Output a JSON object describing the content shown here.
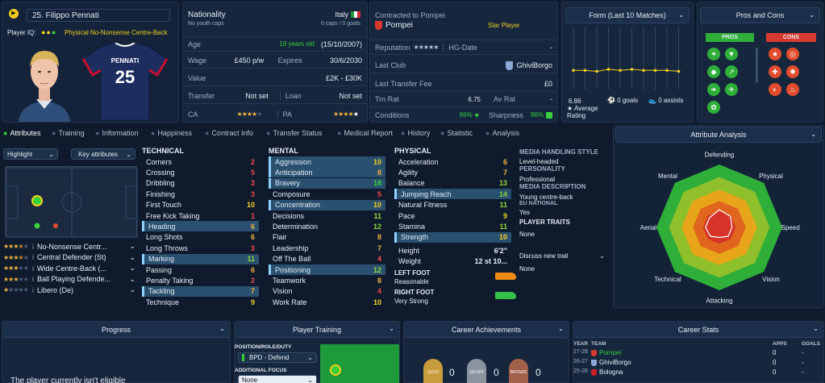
{
  "player": {
    "number_name": "25. Filippo Pennati",
    "iq_label": "Player IQ:",
    "role": "Physical No-Nonsense Centre-Back",
    "shirt_name": "PENNATI",
    "shirt_number": "25"
  },
  "info": {
    "nationality_label": "Nationality",
    "nationality": "Italy",
    "youth_caps": "No youth caps",
    "caps": "0 caps / 0 goals",
    "age_label": "Age",
    "age": "19 years old",
    "dob": "(15/10/2007)",
    "wage_label": "Wage",
    "wage": "£450 p/w",
    "expires_label": "Expires",
    "expires": "30/6/2030",
    "value_label": "Value",
    "value": "£2K - £30K",
    "transfer_label": "Transfer",
    "transfer": "Not set",
    "loan_label": "Loan",
    "loan": "Not set",
    "ca_label": "CA",
    "pa_label": "PA",
    "contracted_label": "Contracted to Pompei",
    "club": "Pompei",
    "status": "Star Player",
    "reputation_label": "Reputation",
    "reputation_right": "HG-Date",
    "reputation_right_value": "-",
    "last_club_label": "Last Club",
    "last_club": "GhiviBorgo",
    "last_fee_label": "Last Transfer Fee",
    "last_fee": "£0",
    "trn_label": "Trn Rat",
    "trn": "6.75",
    "av_label": "Av Rat",
    "av": "-",
    "cond_label": "Conditions",
    "cond": "86%",
    "sharp_label": "Sharpness",
    "sharp": "96%"
  },
  "form": {
    "title": "Form (Last 10 Matches)",
    "avg": "6.86",
    "avg_label": "Average Rating",
    "goals": "0 goals",
    "assists": "0 assists",
    "values": [
      6.9,
      6.9,
      6.8,
      7.0,
      6.9,
      7.0,
      6.9,
      6.9,
      6.9,
      6.8
    ]
  },
  "pros_cons": {
    "title": "Pros and Cons",
    "pros": "PROS",
    "cons": "CONS"
  },
  "tabs": [
    "Attributes",
    "Training",
    "Information",
    "Happiness",
    "Contract Info",
    "Transfer Status",
    "Medical Report",
    "History",
    "Statistic",
    "Analysis"
  ],
  "controls": {
    "highlight": "Highlight",
    "key": "Key attributes"
  },
  "technical": {
    "title": "TECHNICAL",
    "items": [
      [
        "Corners",
        "2"
      ],
      [
        "Crossing",
        "5"
      ],
      [
        "Dribbling",
        "3"
      ],
      [
        "Finishing",
        "3"
      ],
      [
        "First Touch",
        "10"
      ],
      [
        "Free Kick Taking",
        "1"
      ],
      [
        "Heading",
        "6"
      ],
      [
        "Long Shots",
        "6"
      ],
      [
        "Long Throws",
        "3"
      ],
      [
        "Marking",
        "11"
      ],
      [
        "Passing",
        "6"
      ],
      [
        "Penalty Taking",
        "2"
      ],
      [
        "Tackling",
        "7"
      ],
      [
        "Technique",
        "9"
      ]
    ]
  },
  "mental": {
    "title": "MENTAL",
    "items": [
      [
        "Aggression",
        "10"
      ],
      [
        "Anticipation",
        "8"
      ],
      [
        "Bravery",
        "18"
      ],
      [
        "Composure",
        "5"
      ],
      [
        "Concentration",
        "10"
      ],
      [
        "Decisions",
        "11"
      ],
      [
        "Determination",
        "12"
      ],
      [
        "Flair",
        "8"
      ],
      [
        "Leadership",
        "7"
      ],
      [
        "Off The Ball",
        "4"
      ],
      [
        "Positioning",
        "12"
      ],
      [
        "Teamwork",
        "8"
      ],
      [
        "Vision",
        "4"
      ],
      [
        "Work Rate",
        "10"
      ]
    ]
  },
  "physical": {
    "title": "PHYSICAL",
    "items": [
      [
        "Acceleration",
        "6"
      ],
      [
        "Agility",
        "7"
      ],
      [
        "Balance",
        "13"
      ],
      [
        "Jumping Reach",
        "14"
      ],
      [
        "Natural Fitness",
        "11"
      ],
      [
        "Pace",
        "9"
      ],
      [
        "Stamina",
        "11"
      ],
      [
        "Strength",
        "10"
      ]
    ],
    "height_label": "Height",
    "height": "6'2\"",
    "weight_label": "Weight",
    "weight": "12 st 10...",
    "left_foot_label": "LEFT FOOT",
    "left_foot": "Reasonable",
    "right_foot_label": "RIGHT FOOT",
    "right_foot": "Very Strong"
  },
  "profile": {
    "media_label": "MEDIA HANDLING STYLE",
    "media": "Level-headed",
    "personality_label": "PERSONALITY",
    "personality": "Professional",
    "desc_label": "MEDIA DESCRIPTION",
    "desc": "Young centre-back",
    "eu_label": "EU NATIONAL",
    "eu": "Yes",
    "traits_label": "PLAYER TRAITS",
    "traits": "None",
    "discuss": "Discuss new trait",
    "traits2": "None"
  },
  "roles": [
    {
      "label": "No-Nonsense Centr...",
      "stars": 3.5
    },
    {
      "label": "Central Defender (St)",
      "stars": 3.5
    },
    {
      "label": "Wide Centre-Back (...",
      "stars": 3
    },
    {
      "label": "Ball Playing Defende...",
      "stars": 3
    },
    {
      "label": "Libero (De)",
      "stars": 1
    }
  ],
  "analysis": {
    "title": "Attribute Analysis",
    "labels": [
      "Defending",
      "Physical",
      "Speed",
      "Vision",
      "Attacking",
      "Technical",
      "Aerial",
      "Mental"
    ]
  },
  "bottom": {
    "progress": "Progress",
    "training": "Player Training",
    "prd_label": "POSITION/ROLE/DUTY",
    "prd": "BPD - Defend",
    "focus_label": "ADDITIONAL FOCUS",
    "focus": "None",
    "achievements": "Career Achievements",
    "ach_counts": [
      "0",
      "0",
      "0"
    ],
    "career": "Career Stats",
    "bottom_text": "The player currently isn't eligible",
    "career_head": [
      "YEAR",
      "TEAM",
      "APPS",
      "GOALS"
    ],
    "career_rows": [
      [
        "27-28",
        "Pompei",
        "0",
        "-"
      ],
      [
        "26-27",
        "GhiviBorgo",
        "0",
        "-"
      ],
      [
        "25-26",
        "Bologna",
        "0",
        "-"
      ]
    ]
  },
  "colors": {
    "accent_green": "#35d03c",
    "pro_green": "#2fae3a",
    "con_red": "#d63a2e"
  }
}
